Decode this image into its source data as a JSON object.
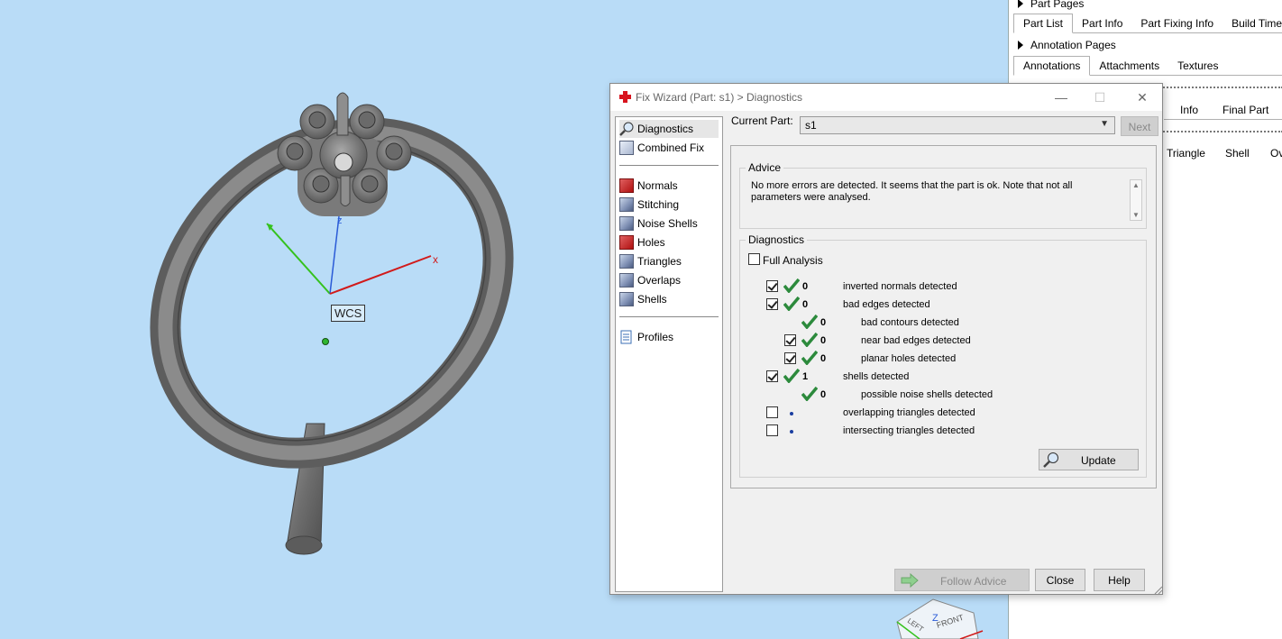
{
  "viewport": {
    "wcs_label": "WCS",
    "axis_x": "x",
    "axis_z": "z",
    "view_cube": {
      "left": "LEFT",
      "front": "FRONT",
      "z": "Z"
    }
  },
  "right_panel": {
    "part_pages_label": "Part Pages",
    "part_tabs": [
      "Part List",
      "Part Info",
      "Part Fixing Info",
      "Build Time"
    ],
    "annotation_pages_label": "Annotation Pages",
    "annotation_tabs": [
      "Annotations",
      "Attachments",
      "Textures"
    ],
    "tabs_row3": [
      "Info",
      "Final Part"
    ],
    "columns": [
      "Triangle",
      "Shell",
      "Ov"
    ]
  },
  "dialog": {
    "title": "Fix Wizard (Part: s1) > Diagnostics",
    "controls": {
      "minimize": "—",
      "maximize": "☐",
      "close": "✕"
    },
    "nav": {
      "diagnostics": "Diagnostics",
      "combined_fix": "Combined Fix",
      "normals": "Normals",
      "stitching": "Stitching",
      "noise_shells": "Noise Shells",
      "holes": "Holes",
      "triangles": "Triangles",
      "overlaps": "Overlaps",
      "shells": "Shells",
      "profiles": "Profiles"
    },
    "current_part_label": "Current Part:",
    "current_part_value": "s1",
    "next_label": "Next",
    "advice_title": "Advice",
    "advice_text": "No more errors are detected. It seems that the part is ok. Note that not all parameters were analysed.",
    "diagnostics_title": "Diagnostics",
    "full_analysis_label": "Full Analysis",
    "rows": {
      "inverted_normals": {
        "count": "0",
        "label": "inverted normals detected"
      },
      "bad_edges": {
        "count": "0",
        "label": "bad edges detected"
      },
      "bad_contours": {
        "count": "0",
        "label": "bad contours detected"
      },
      "near_bad_edges": {
        "count": "0",
        "label": "near bad edges detected"
      },
      "planar_holes": {
        "count": "0",
        "label": "planar holes detected"
      },
      "shells": {
        "count": "1",
        "label": "shells detected"
      },
      "noise_shells": {
        "count": "0",
        "label": "possible noise shells detected"
      },
      "overlapping": {
        "label": "overlapping triangles detected"
      },
      "intersecting": {
        "label": "intersecting triangles detected"
      }
    },
    "update_label": "Update",
    "follow_advice_label": "Follow Advice",
    "close_label": "Close",
    "help_label": "Help"
  },
  "colors": {
    "viewport_bg": "#b9dcf7",
    "check_green": "#2c8a3c",
    "close_red": "#d8141e"
  }
}
